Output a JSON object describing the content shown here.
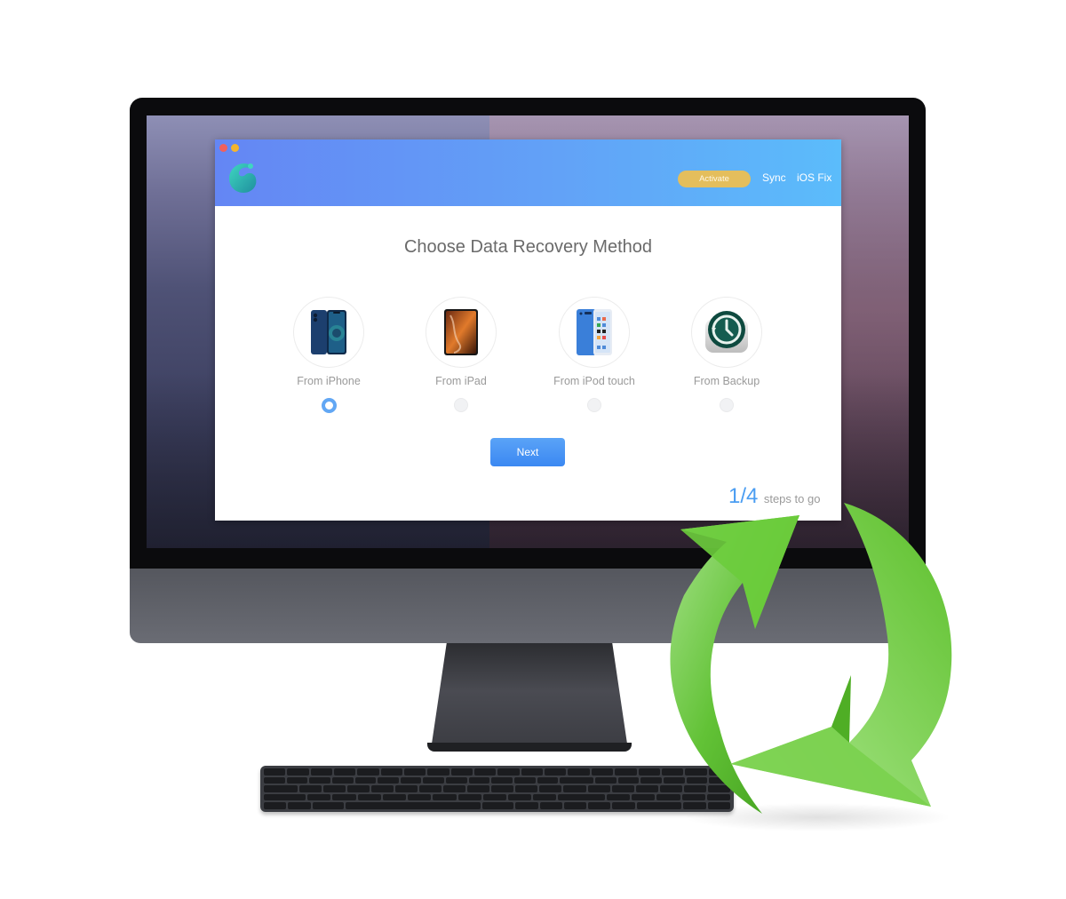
{
  "app": {
    "header": {
      "activate_label": "Activate",
      "nav": [
        "Sync",
        "iOS Fix"
      ]
    },
    "title": "Choose Data Recovery Method",
    "methods": [
      {
        "label": "From iPhone",
        "icon": "iphone-icon",
        "selected": true
      },
      {
        "label": "From iPad",
        "icon": "ipad-icon",
        "selected": false
      },
      {
        "label": "From iPod touch",
        "icon": "ipod-touch-icon",
        "selected": false
      },
      {
        "label": "From Backup",
        "icon": "time-machine-backup-icon",
        "selected": false
      }
    ],
    "next_label": "Next",
    "steps": {
      "count": "1/4",
      "text": "steps to go"
    }
  },
  "colors": {
    "header_gradient_start": "#6486f4",
    "header_gradient_end": "#5bbcfb",
    "activate": "#e4be5c",
    "accent_blue": "#4a9df2",
    "arrow_green": "#5cbf2a"
  }
}
